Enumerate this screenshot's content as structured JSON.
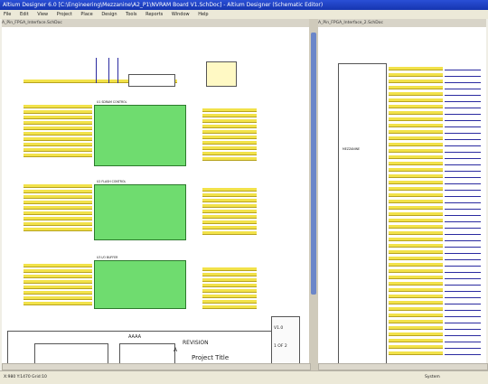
{
  "window": {
    "title": "Altium Designer 6.0  [C:\\Engineering\\Mezzanine\\A2_P1\\NVRAM Board V1.SchDoc]  -  Altium Designer  (Schematic Editor)"
  },
  "menu": [
    "File",
    "Edit",
    "View",
    "Project",
    "Place",
    "Design",
    "Tools",
    "Reports",
    "Window",
    "Help"
  ],
  "tabs": {
    "left": "A_Pin_FPGA_Interface.SchDoc",
    "right": "A_Pin_FPGA_Interface_2.SchDoc"
  },
  "schematic": {
    "sheet_title": "Project Title",
    "revision": "V1.0",
    "sheet_label": "1 OF 2",
    "date_label": "REVISION",
    "code": "A",
    "title_left": "AAAA",
    "blocks": [
      "U1 SDRAM CONTROL",
      "U2 FLASH CONTROL",
      "U3 I/O BUFFER"
    ],
    "connector_ref": "MEZZANINE"
  },
  "status": {
    "left": "X:980 Y:1470  Grid:10",
    "right": "System"
  },
  "colors": {
    "title": "#1535b0",
    "green": "#6fdc6f",
    "yellow": "#f2e24a",
    "net_red": "#c51d1d"
  }
}
